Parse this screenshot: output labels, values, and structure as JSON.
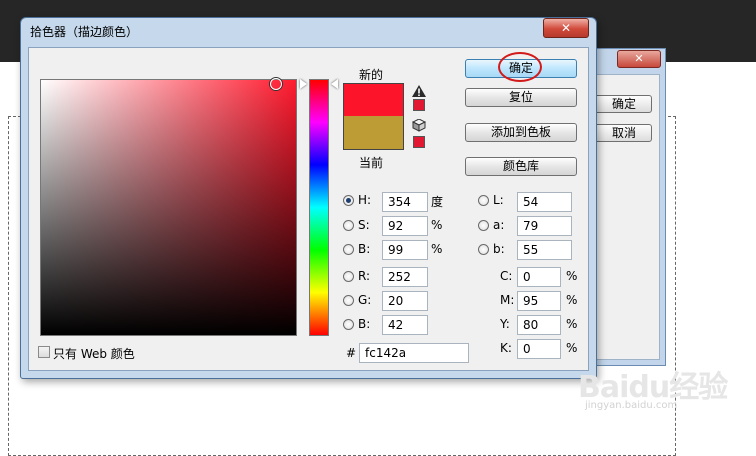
{
  "dialog": {
    "title": "拾色器（描边颜色）",
    "close_glyph": "✕"
  },
  "background_dialog": {
    "close_glyph": "✕",
    "ok_label": "确定",
    "cancel_label": "取消"
  },
  "swatches": {
    "new_label": "新的",
    "current_label": "当前",
    "new_color": "#fc142a",
    "current_color": "#bd9b35",
    "warning_swatch_color": "#e21833",
    "web_swatch_color": "#e21833"
  },
  "buttons": {
    "ok": "确定",
    "reset": "复位",
    "add_to_swatches": "添加到色板",
    "color_libraries": "颜色库"
  },
  "hsb": {
    "h_label": "H:",
    "h_value": "354",
    "h_unit": "度",
    "s_label": "S:",
    "s_value": "92",
    "s_unit": "%",
    "b_label": "B:",
    "b_value": "99",
    "b_unit": "%"
  },
  "rgb": {
    "r_label": "R:",
    "r_value": "252",
    "g_label": "G:",
    "g_value": "20",
    "b_label": "B:",
    "b_value": "42"
  },
  "lab": {
    "l_label": "L:",
    "l_value": "54",
    "a_label": "a:",
    "a_value": "79",
    "b_label": "b:",
    "b_value": "55"
  },
  "cmyk": {
    "c_label": "C:",
    "c_value": "0",
    "c_unit": "%",
    "m_label": "M:",
    "m_value": "95",
    "m_unit": "%",
    "y_label": "Y:",
    "y_value": "80",
    "y_unit": "%",
    "k_label": "K:",
    "k_value": "0",
    "k_unit": "%"
  },
  "hex": {
    "label": "#",
    "value": "fc142a"
  },
  "web_only": {
    "label": "只有 Web 颜色",
    "checked": false
  },
  "watermark": {
    "brand": "Baidu经验",
    "url": "jingyan.baidu.com"
  }
}
